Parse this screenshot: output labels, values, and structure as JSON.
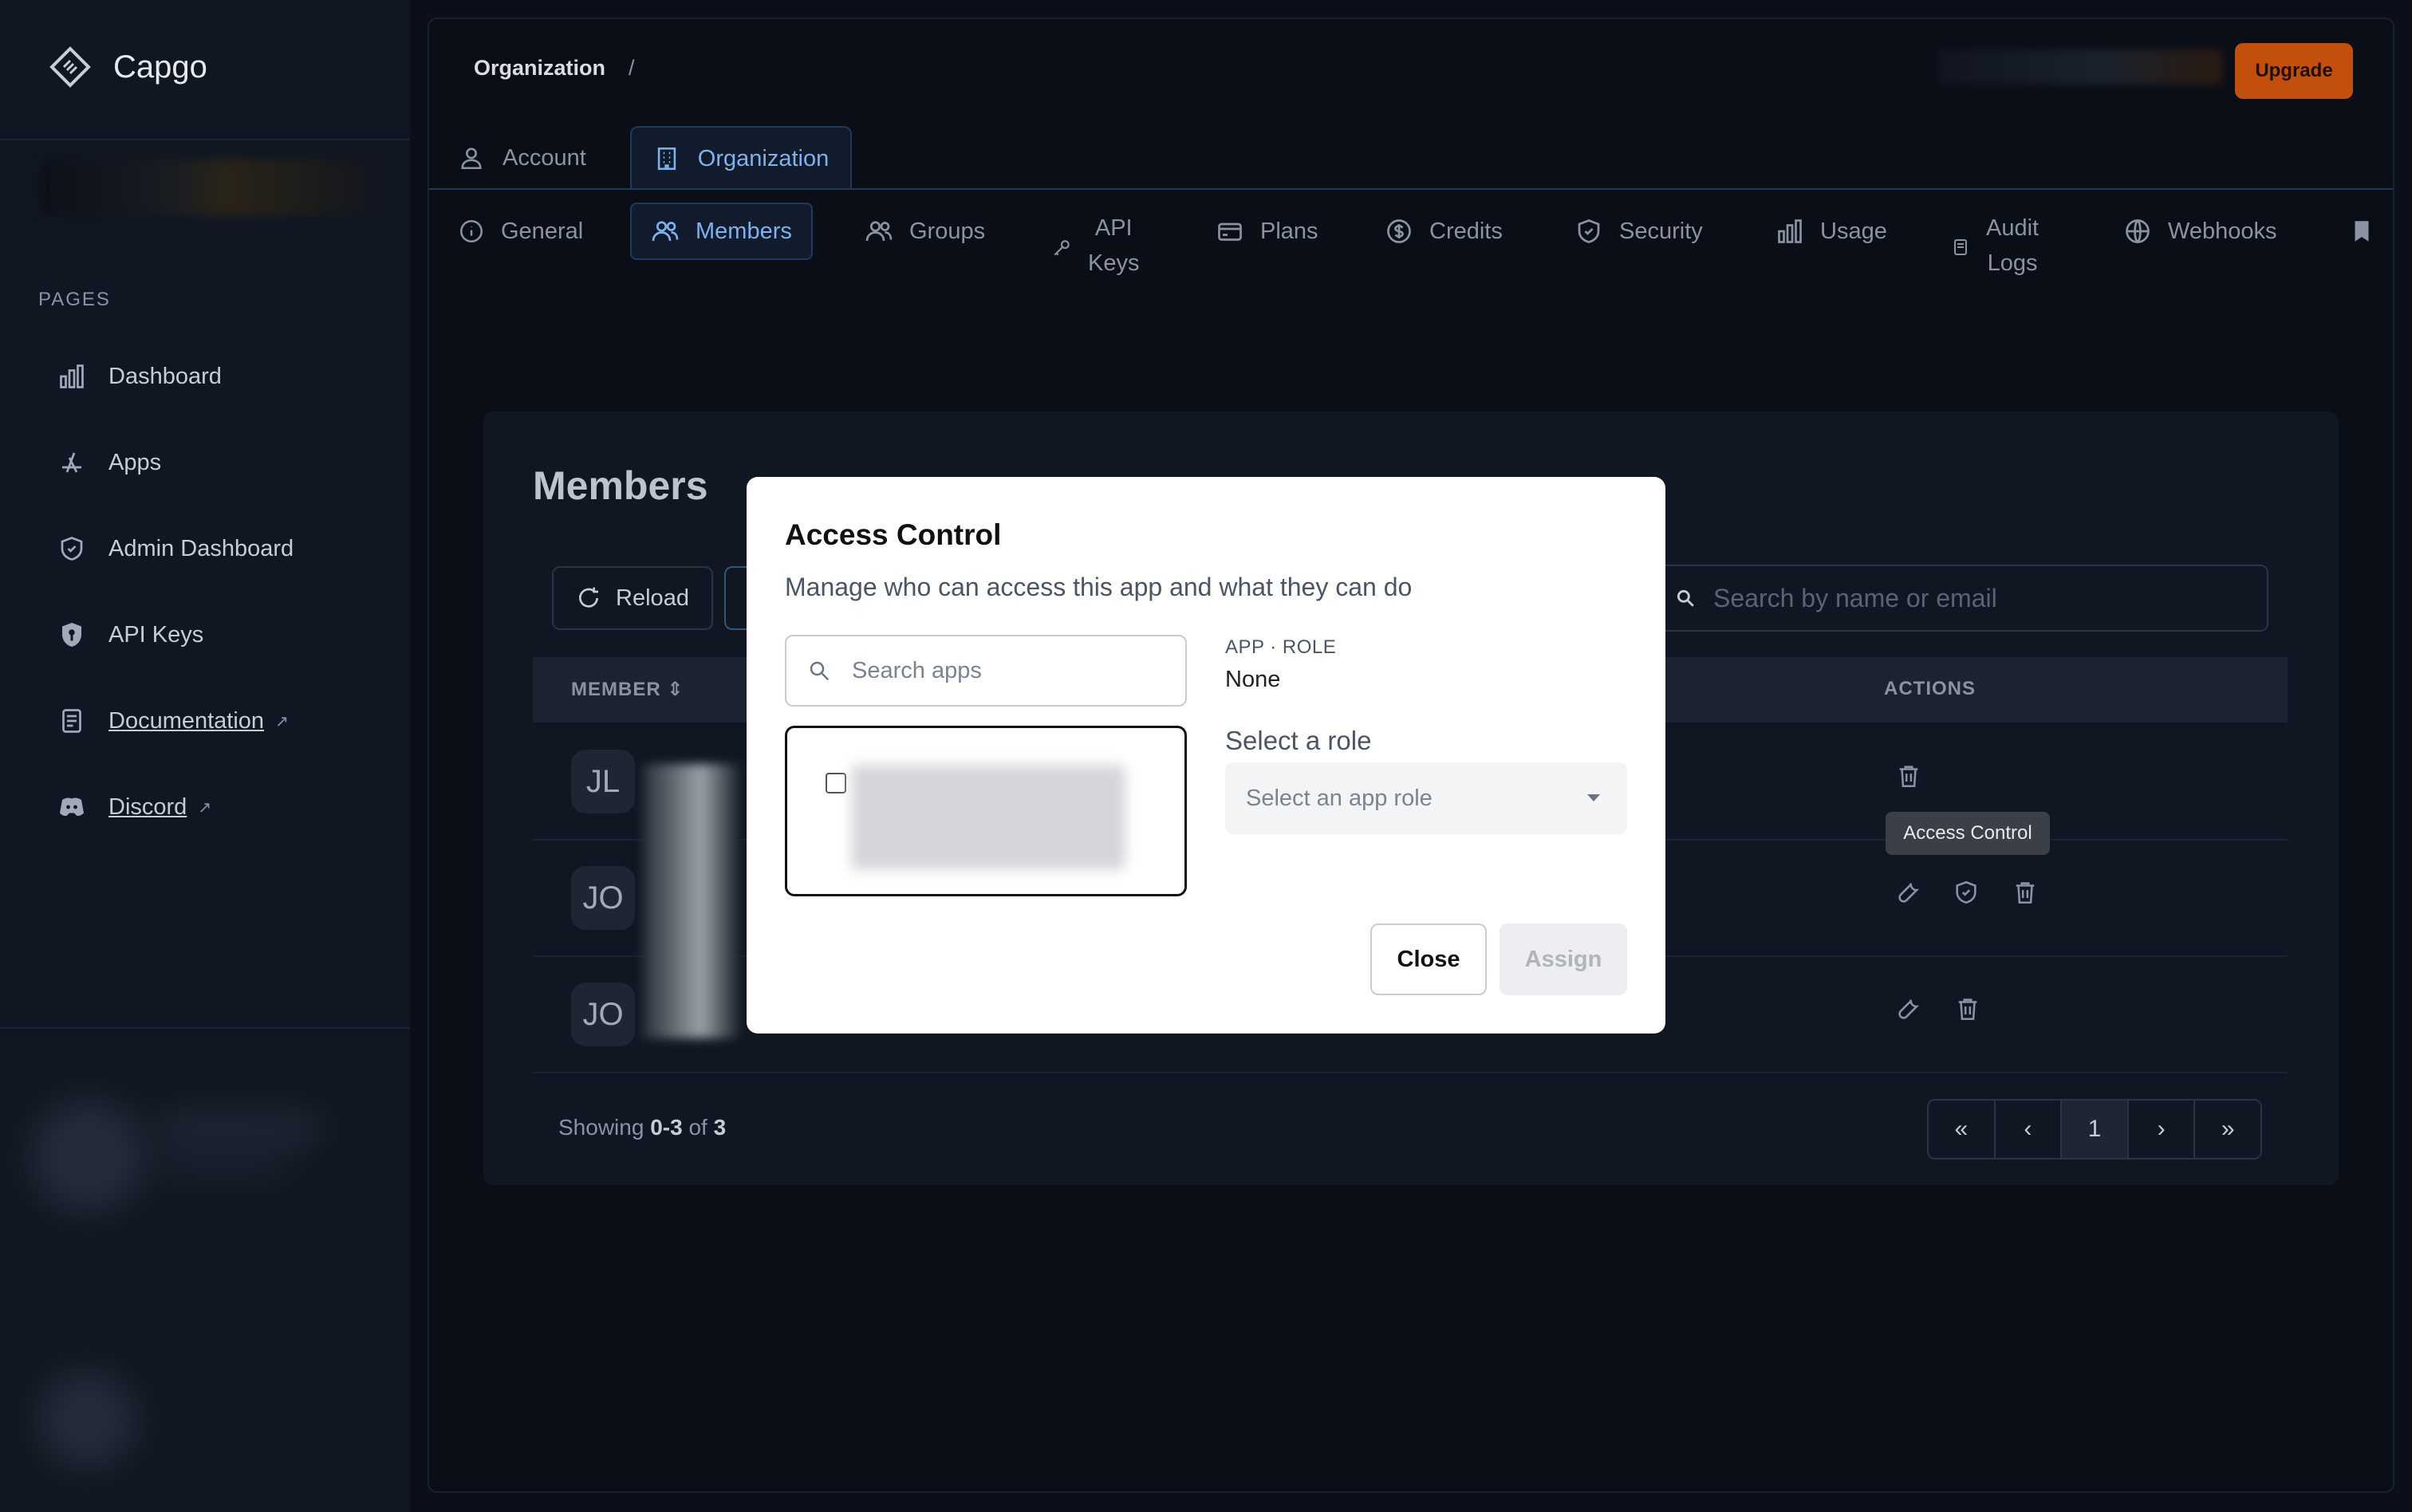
{
  "app": {
    "name": "Capgo"
  },
  "sidebar": {
    "section_label": "PAGES",
    "items": [
      {
        "label": "Dashboard",
        "icon": "bar-chart-icon"
      },
      {
        "label": "Apps",
        "icon": "app-store-icon"
      },
      {
        "label": "Admin Dashboard",
        "icon": "shield-check-icon"
      },
      {
        "label": "API Keys",
        "icon": "key-shield-icon"
      },
      {
        "label": "Documentation",
        "icon": "document-icon",
        "external": true
      },
      {
        "label": "Discord",
        "icon": "discord-icon",
        "external": true
      }
    ]
  },
  "header": {
    "breadcrumb": "Organization",
    "separator": "/",
    "upgrade_label": "Upgrade"
  },
  "tabs": [
    {
      "label": "Account"
    },
    {
      "label": "Organization",
      "active": true
    }
  ],
  "subtabs": [
    {
      "label": "General"
    },
    {
      "label": "Members",
      "active": true
    },
    {
      "label": "Groups"
    },
    {
      "label": "API",
      "label2": "Keys"
    },
    {
      "label": "Plans"
    },
    {
      "label": "Credits"
    },
    {
      "label": "Security"
    },
    {
      "label": "Usage"
    },
    {
      "label": "Audit",
      "label2": "Logs"
    },
    {
      "label": "Webhooks"
    }
  ],
  "members": {
    "title": "Members",
    "reload_label": "Reload",
    "search_placeholder": "Search by name or email",
    "columns": {
      "member": "MEMBER",
      "actions": "ACTIONS"
    },
    "rows": [
      {
        "initials": "JL"
      },
      {
        "initials": "JO"
      },
      {
        "initials": "JO"
      }
    ],
    "tooltip": "Access Control",
    "showing": {
      "prefix": "Showing",
      "range": "0-3",
      "of": "of",
      "total": "3"
    },
    "pager": {
      "current": "1"
    }
  },
  "modal": {
    "title": "Access Control",
    "subtitle": "Manage who can access this app and what they can do",
    "search_placeholder": "Search apps",
    "app_role_label": "APP · ROLE",
    "app_role_value": "None",
    "select_role_label": "Select a role",
    "select_placeholder": "Select an app role",
    "close_label": "Close",
    "assign_label": "Assign"
  },
  "colors": {
    "accent": "#7cb2f0",
    "upgrade": "#c2500c",
    "background": "#0a0e17"
  }
}
